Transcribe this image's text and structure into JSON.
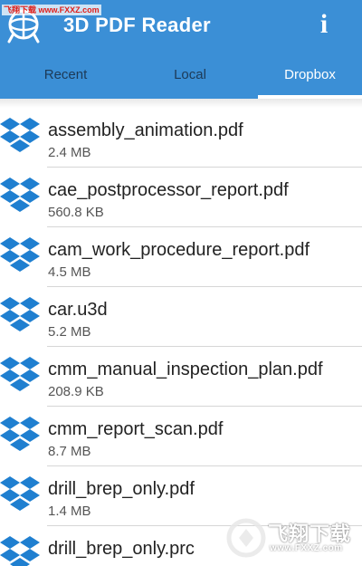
{
  "watermark_top": "飞翔下载 www.FXXZ.com",
  "app": {
    "title": "3D PDF Reader",
    "info_label": "i"
  },
  "tabs": [
    {
      "label": "Recent",
      "active": false
    },
    {
      "label": "Local",
      "active": false
    },
    {
      "label": "Dropbox",
      "active": true
    }
  ],
  "files": [
    {
      "name": "assembly_animation.pdf",
      "size": "2.4 MB"
    },
    {
      "name": "cae_postprocessor_report.pdf",
      "size": "560.8 KB"
    },
    {
      "name": "cam_work_procedure_report.pdf",
      "size": "4.5 MB"
    },
    {
      "name": "car.u3d",
      "size": "5.2 MB"
    },
    {
      "name": "cmm_manual_inspection_plan.pdf",
      "size": "208.9 KB"
    },
    {
      "name": "cmm_report_scan.pdf",
      "size": "8.7 MB"
    },
    {
      "name": "drill_brep_only.pdf",
      "size": "1.4 MB"
    },
    {
      "name": "drill_brep_only.prc",
      "size": ""
    }
  ],
  "watermark_br": {
    "title": "飞翔下载",
    "url": "www.FXXZ.com"
  },
  "colors": {
    "appbar": "#3b8fd6",
    "dropbox_blue": "#1f7fd0",
    "tab_inactive": "#1d3a57"
  }
}
